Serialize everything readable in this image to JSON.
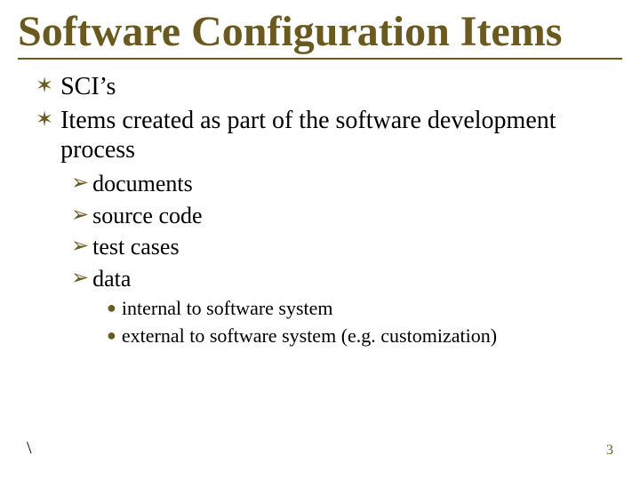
{
  "title": "Software Configuration Items",
  "level1": [
    "SCI’s",
    "Items created as part of the software development process"
  ],
  "level2": [
    "documents",
    "source code",
    "test cases",
    "data"
  ],
  "level3": [
    "internal to software system",
    "external to software system (e.g. customization)"
  ],
  "bullets": {
    "l1": "✶",
    "l2": "➢",
    "l3": "●"
  },
  "footer": {
    "left": "\\",
    "page": "3"
  },
  "colors": {
    "accent": "#6b5a1f"
  }
}
